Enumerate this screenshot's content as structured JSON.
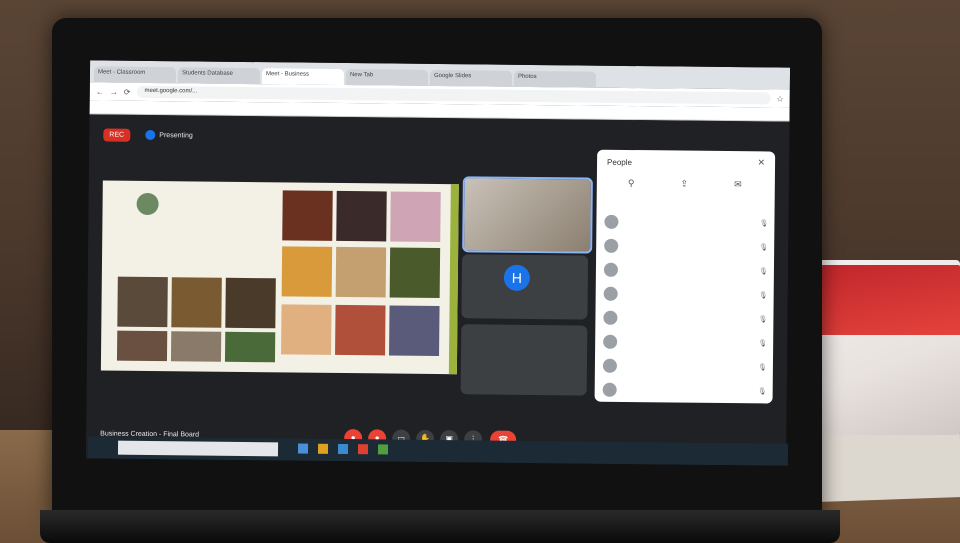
{
  "browser": {
    "tabs": [
      "Meet - Classroom",
      "Students Database",
      "Meet - Business",
      "New Tab",
      "Google Slides",
      "Photos"
    ],
    "active_tab": 2,
    "url": "meet.google.com/..."
  },
  "meet": {
    "rec_label": "REC",
    "presenting_text": "Presenting",
    "participant_h_initial": "H",
    "participant_h_name": "",
    "tile3_name": "",
    "meeting_title": "Business Creation - Final Board"
  },
  "panel": {
    "title": "People",
    "close": "✕",
    "actions": [
      "⚲",
      "⇪",
      "✉"
    ],
    "participants": [
      "",
      "",
      "",
      "",
      "",
      "",
      "",
      ""
    ]
  },
  "controls": [
    "mic-icon",
    "camera-icon",
    "captions-icon",
    "hand-icon",
    "present-icon",
    "more-icon",
    "end-call-icon"
  ],
  "taskbar": {
    "search_placeholder": ""
  },
  "colors": {
    "accent": "#1a73e8",
    "rec": "#d93025",
    "end_call": "#ea4335",
    "slide_border": "#9bb23c"
  }
}
